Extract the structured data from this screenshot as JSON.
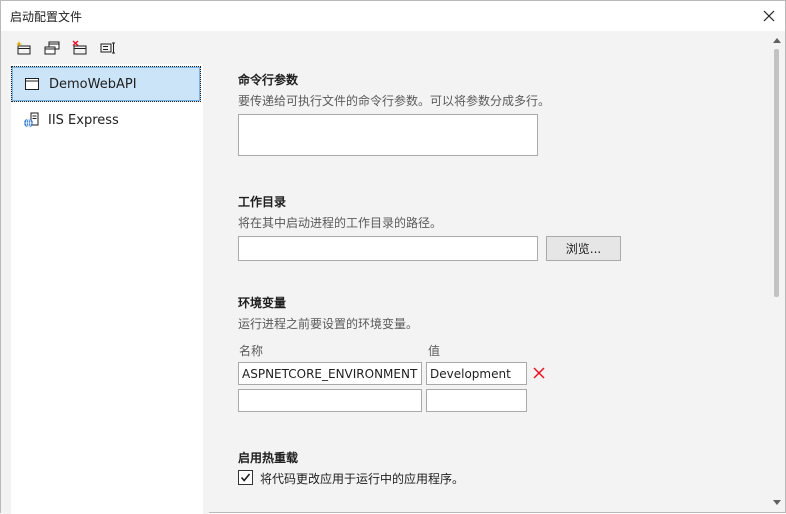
{
  "window": {
    "title": "启动配置文件"
  },
  "toolbar": {
    "buttons": [
      {
        "icon": "new-profile-icon"
      },
      {
        "icon": "copy-profile-icon"
      },
      {
        "icon": "delete-profile-icon"
      },
      {
        "icon": "rename-profile-icon"
      }
    ]
  },
  "profiles": [
    {
      "label": "DemoWebAPI",
      "icon": "window-icon",
      "selected": true
    },
    {
      "label": "IIS Express",
      "icon": "iis-globe-icon",
      "selected": false
    }
  ],
  "cmdline": {
    "title": "命令行参数",
    "description": "要传递给可执行文件的命令行参数。可以将参数分成多行。",
    "value": ""
  },
  "workdir": {
    "title": "工作目录",
    "description": "将在其中启动进程的工作目录的路径。",
    "value": "",
    "browse_label": "浏览..."
  },
  "envvars": {
    "title": "环境变量",
    "description": "运行进程之前要设置的环境变量。",
    "name_header": "名称",
    "value_header": "值",
    "rows": [
      {
        "name": "ASPNETCORE_ENVIRONMENT",
        "value": "Development"
      },
      {
        "name": "",
        "value": ""
      }
    ]
  },
  "hotreload": {
    "title": "启用热重载",
    "checkbox_label": "将代码更改应用于运行中的应用程序。",
    "checked": true
  },
  "colors": {
    "selection": "#cce4f7",
    "delete_red": "#e81123",
    "border": "#a9a9a9"
  }
}
